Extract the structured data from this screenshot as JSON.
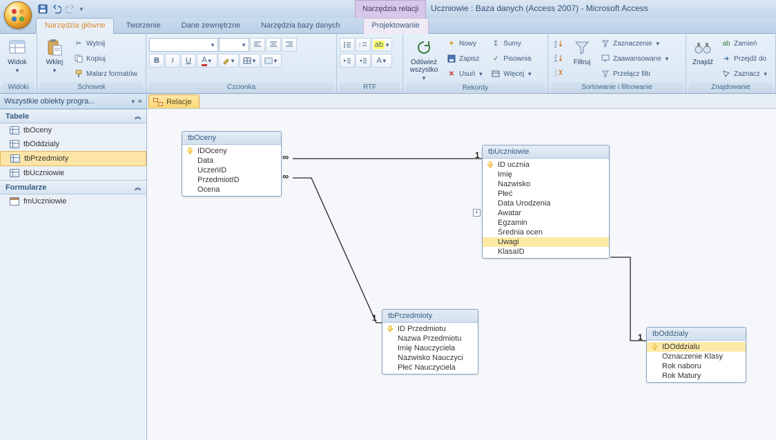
{
  "title_context": "Narzędzia relacji",
  "window_title": "Uczniowie : Baza danych (Access 2007) - Microsoft Access",
  "ribbon_tabs": [
    "Narzędzia główne",
    "Tworzenie",
    "Dane zewnętrzne",
    "Narzędzia bazy danych",
    "Projektowanie"
  ],
  "ribbon": {
    "widoki": {
      "label": "Widoki",
      "btn": "Widok"
    },
    "schowek": {
      "label": "Schowek",
      "paste": "Wklej",
      "cut": "Wytnij",
      "copy": "Kopiuj",
      "painter": "Malarz formatów"
    },
    "czcionka": {
      "label": "Czcionka"
    },
    "rtf": {
      "label": "RTF"
    },
    "rekordy": {
      "label": "Rekordy",
      "refresh_l1": "Odśwież",
      "refresh_l2": "wszystko",
      "new": "Nowy",
      "save": "Zapisz",
      "delete": "Usuń",
      "sums": "Sumy",
      "spelling": "Pisownia",
      "more": "Więcej"
    },
    "sortfilter": {
      "label": "Sortowanie i filtrowanie",
      "filter": "Filtruj",
      "sel": "Zaznaczenie",
      "adv": "Zaawansowane",
      "toggle": "Przełącz filtr"
    },
    "find": {
      "label": "Znajdowanie",
      "find": "Znajdź",
      "replace": "Zamień",
      "goto": "Przejdź do",
      "select": "Zaznacz"
    }
  },
  "navpane": {
    "header": "Wszystkie obiekty progra...",
    "cat_tables": "Tabele",
    "tables": [
      "tbOceny",
      "tbOddzialy",
      "tbPrzedmioty",
      "tbUczniowie"
    ],
    "cat_forms": "Formularze",
    "forms": [
      "fmUczniowie"
    ]
  },
  "doctab": "Relacje",
  "boxes": {
    "tbOceny": {
      "title": "tbOceny",
      "fields": [
        "IDOceny",
        "Data",
        "UczeńID",
        "PrzedmiotID",
        "Ocena"
      ],
      "pk": 0
    },
    "tbUczniowie": {
      "title": "tbUczniowie",
      "fields": [
        "ID ucznia",
        "Imię",
        "Nazwisko",
        "Płeć",
        "Data Urodzenia",
        "Awatar",
        "Egzamin",
        "Średnia ocen",
        "Uwagi",
        "KlasaID"
      ],
      "pk": 0,
      "hl": 8,
      "expand": 5
    },
    "tbPrzedmioty": {
      "title": "tbPrzedmioty",
      "fields": [
        "ID Przedmiotu",
        "Nazwa Przedmiotu",
        "Imię Nauczyciela",
        "Nazwisko Nauczyci",
        "Płeć Nauczyciela"
      ],
      "pk": 0
    },
    "tbOddzialy": {
      "title": "tbOddzialy",
      "fields": [
        "IDOddzialu",
        "Oznaczenie Klasy",
        "Rok naboru",
        "Rok Matury"
      ],
      "pk": 0,
      "hl": 0
    }
  },
  "card": {
    "one": "1",
    "many": "∞"
  }
}
